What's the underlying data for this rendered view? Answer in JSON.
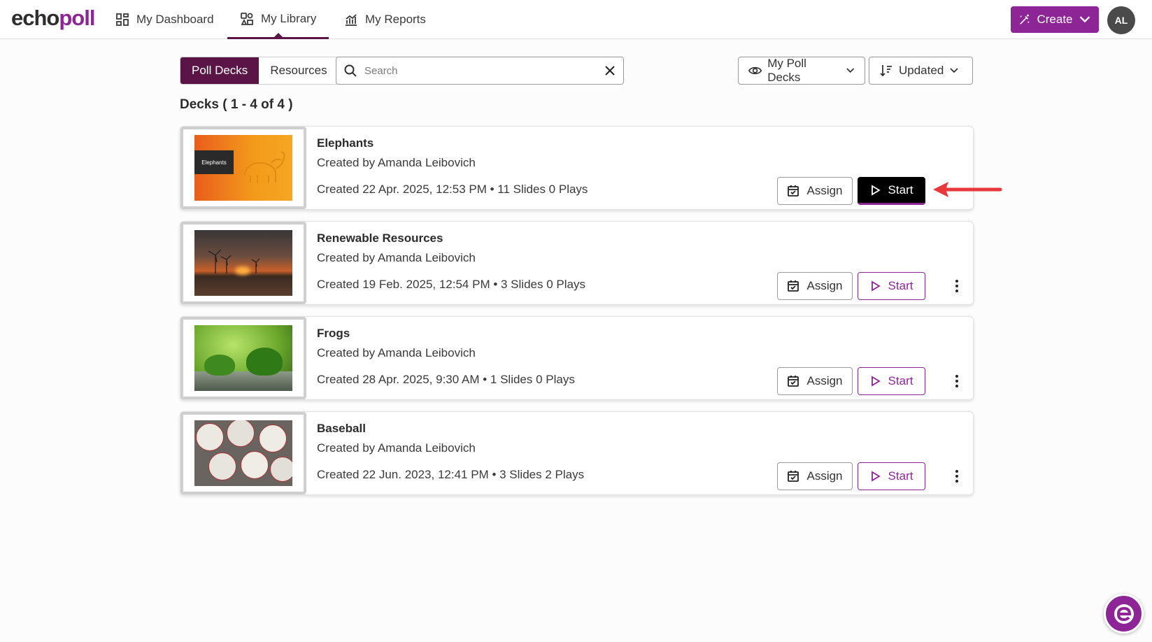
{
  "app": {
    "logo_part1": "echo",
    "logo_part2": "poll",
    "nav": [
      {
        "label": "My Dashboard",
        "icon": "dashboard-icon"
      },
      {
        "label": "My Library",
        "icon": "library-icon",
        "active": true
      },
      {
        "label": "My Reports",
        "icon": "reports-icon"
      }
    ],
    "create_label": "Create",
    "avatar_initials": "AL",
    "accent_color": "#8e2597",
    "dark_color": "#5a1446"
  },
  "toolbar": {
    "tabs": [
      {
        "label": "Poll Decks",
        "selected": true
      },
      {
        "label": "Resources",
        "selected": false
      }
    ],
    "search_placeholder": "Search",
    "filter_label": "My Poll Decks",
    "sort_label": "Updated"
  },
  "list": {
    "count_label": "Decks ( 1 - 4 of 4 )",
    "assign_label": "Assign",
    "start_label": "Start",
    "decks": [
      {
        "title": "Elephants",
        "creator": "Created by  Amanda Leibovich",
        "meta": "Created 22 Apr. 2025, 12:53 PM • 11 Slides 0 Plays",
        "thumb_text": "Elephants",
        "thumb": "elephants-slide"
      },
      {
        "title": "Renewable Resources",
        "creator": "Created by  Amanda Leibovich",
        "meta": "Created 19 Feb. 2025, 12:54 PM • 3 Slides 0 Plays",
        "thumb": "wind-turbines-sunset"
      },
      {
        "title": "Frogs",
        "creator": "Created by  Amanda Leibovich",
        "meta": "Created 28 Apr. 2025, 9:30 AM • 1 Slides 0 Plays",
        "thumb": "green-frogs"
      },
      {
        "title": "Baseball",
        "creator": "Created by  Amanda Leibovich",
        "meta": "Created 22 Jun. 2023, 12:41 PM • 3 Slides 2 Plays",
        "thumb": "baseballs"
      }
    ]
  }
}
